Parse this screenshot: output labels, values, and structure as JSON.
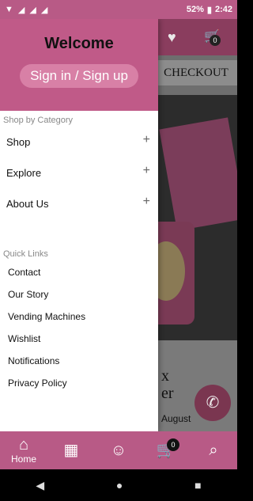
{
  "status_bar": {
    "battery": "52%",
    "time": "2:42"
  },
  "background": {
    "cart_count": "0",
    "checkout_label": "CHECKOUT",
    "text_line1": "x",
    "text_line2": "er",
    "date": "August"
  },
  "drawer": {
    "welcome": "Welcome",
    "signin_label": "Sign in / Sign up",
    "shop_by_category_label": "Shop by Category",
    "categories": [
      {
        "label": "Shop"
      },
      {
        "label": "Explore"
      },
      {
        "label": "About Us"
      }
    ],
    "quick_links_label": "Quick Links",
    "quick_links": [
      {
        "label": "Contact"
      },
      {
        "label": "Our Story"
      },
      {
        "label": "Vending Machines"
      },
      {
        "label": "Wishlist"
      },
      {
        "label": "Notifications"
      },
      {
        "label": "Privacy Policy"
      }
    ]
  },
  "tab_bar": {
    "items": [
      {
        "label": "Home",
        "icon": "home-icon"
      },
      {
        "label": "",
        "icon": "catalog-icon"
      },
      {
        "label": "",
        "icon": "user-icon"
      },
      {
        "label": "",
        "icon": "cart-icon",
        "badge": "0"
      },
      {
        "label": "",
        "icon": "search-icon"
      }
    ]
  }
}
